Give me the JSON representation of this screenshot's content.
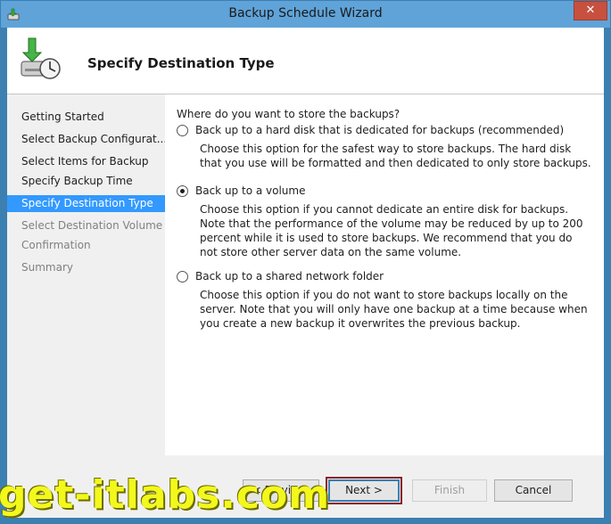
{
  "window": {
    "title": "Backup Schedule Wizard",
    "close_label": "✕"
  },
  "header": {
    "title": "Specify Destination Type"
  },
  "nav": {
    "items": [
      {
        "label": "Getting Started",
        "state": "done"
      },
      {
        "label": "Select Backup Configurat...",
        "state": "done"
      },
      {
        "label": "Select Items for Backup",
        "state": "done"
      },
      {
        "label": "Specify Backup Time",
        "state": "done"
      },
      {
        "label": "Specify Destination Type",
        "state": "selected"
      },
      {
        "label": "Select Destination Volume",
        "state": "disabled"
      },
      {
        "label": "Confirmation",
        "state": "disabled"
      },
      {
        "label": "Summary",
        "state": "disabled"
      }
    ]
  },
  "main": {
    "question": "Where do you want to store the backups?",
    "options": [
      {
        "label": "Back up to a hard disk that is dedicated for backups (recommended)",
        "description": "Choose this option for the safest way to store backups. The hard disk that you use will be formatted and then dedicated to only store backups.",
        "checked": false
      },
      {
        "label": "Back up to a volume",
        "description": "Choose this option if you cannot dedicate an entire disk for backups. Note that the performance of the volume may be reduced by up to 200 percent while it is used to store backups. We recommend that you do not store other server data on the same volume.",
        "checked": true
      },
      {
        "label": "Back up to a shared network folder",
        "description": "Choose this option if you do not want to store backups locally on the server. Note that you will only have one backup at a time because when you create a new backup it overwrites the previous backup.",
        "checked": false
      }
    ]
  },
  "footer": {
    "previous_label": "< Previous",
    "next_label": "Next >",
    "finish_label": "Finish",
    "cancel_label": "Cancel"
  },
  "watermark": {
    "text": "get-itlabs.com"
  },
  "colors": {
    "title_bar": "#5fa3d8",
    "selected_nav": "#3399ff",
    "close_button": "#c7503f",
    "highlight_box": "#8b1c2b",
    "watermark": "#f3f81c"
  }
}
